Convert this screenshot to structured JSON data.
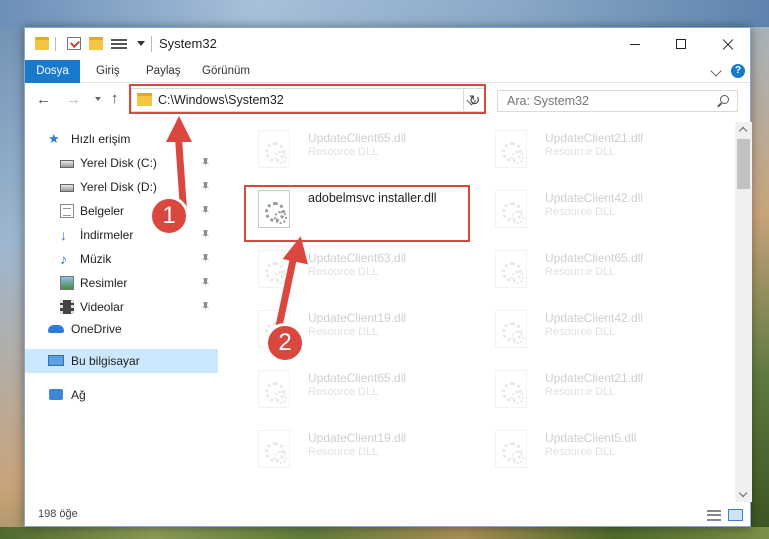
{
  "window": {
    "title": "System32"
  },
  "ribbon": {
    "tabs": [
      "Dosya",
      "Giriş",
      "Paylaş",
      "Görünüm"
    ]
  },
  "address": {
    "path": "C:\\Windows\\System32",
    "search_placeholder": "Ara: System32"
  },
  "navpane": {
    "quick_access": "Hızlı erişim",
    "quick_items": [
      "Yerel Disk (C:)",
      "Yerel Disk (D:)",
      "Belgeler",
      "İndirmeler",
      "Müzik",
      "Resimler",
      "Videolar"
    ],
    "onedrive": "OneDrive",
    "this_pc": "Bu bilgisayar",
    "network": "Ağ"
  },
  "files": {
    "selected": {
      "name": "adobelmsvc installer.dll"
    },
    "left_column": [
      {
        "name": "UpdateClient65.dll",
        "type": "Resource DLL"
      },
      {
        "name": "UpdateClient63.dll",
        "type": "Resource DLL"
      },
      {
        "name": "UpdateClient19.dll",
        "type": "Resource DLL"
      },
      {
        "name": "UpdateClient65.dll",
        "type": "Resource DLL"
      },
      {
        "name": "UpdateClient19.dll",
        "type": "Resource DLL"
      }
    ],
    "right_column": [
      {
        "name": "UpdateClient21.dll",
        "type": "Resource DLL"
      },
      {
        "name": "UpdateClient42.dll",
        "type": "Resource DLL"
      },
      {
        "name": "UpdateClient65.dll",
        "type": "Resource DLL"
      },
      {
        "name": "UpdateClient42.dll",
        "type": "Resource DLL"
      },
      {
        "name": "UpdateClient21.dll",
        "type": "Resource DLL"
      },
      {
        "name": "UpdateClient5.dll",
        "type": "Resource DLL"
      }
    ]
  },
  "annotations": {
    "step1": "1",
    "step2": "2",
    "color": "#d9473f"
  },
  "status": {
    "item_count": "198 öğe"
  },
  "colors": {
    "accent": "#1979ca",
    "selection": "#cce8ff"
  }
}
